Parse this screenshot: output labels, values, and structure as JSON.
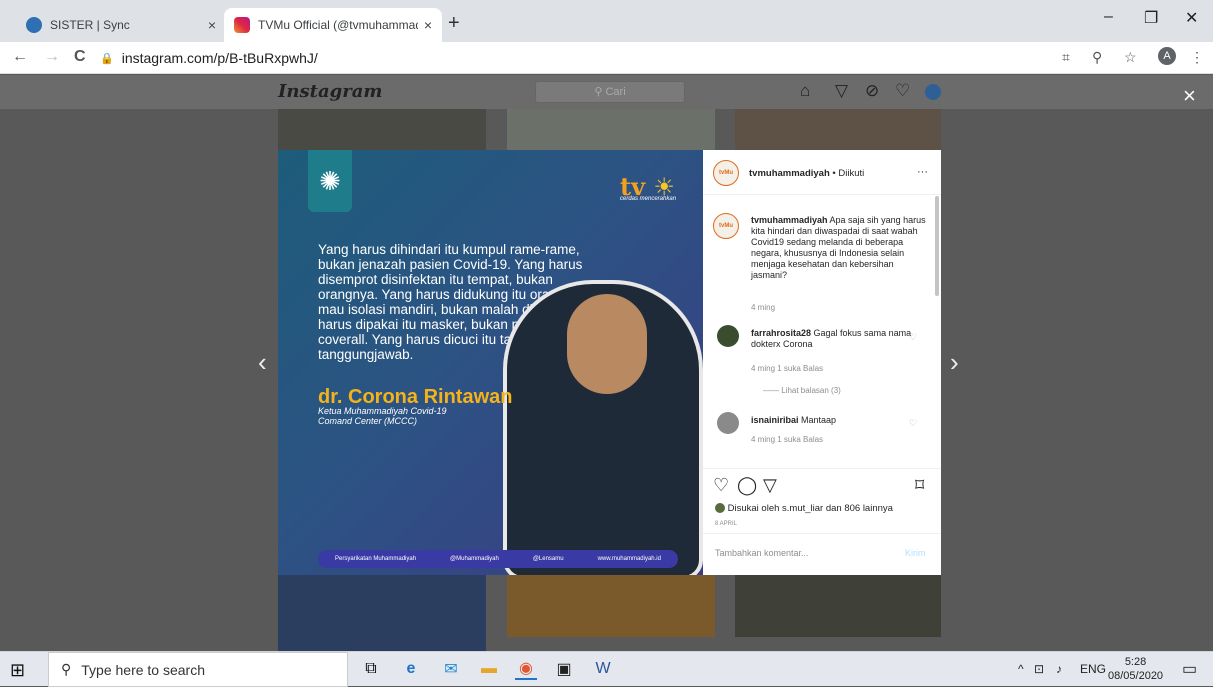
{
  "browser": {
    "tabs": [
      {
        "title": "SISTER | Sync",
        "close": "×"
      },
      {
        "title": "TVMu Official (@tvmuhammadiy",
        "close": "×"
      }
    ],
    "new_tab": "+",
    "url": "instagram.com/p/B-tBuRxpwhJ/",
    "profile_initial": "A",
    "window": {
      "minimize": "–",
      "maximize": "❐",
      "close": "✕"
    },
    "nav": {
      "back": "←",
      "forward": "→",
      "reload": "C"
    }
  },
  "instagram": {
    "logo": "Instagram",
    "search_placeholder": "Cari",
    "close": "×",
    "prev": "‹",
    "next": "›"
  },
  "post_image": {
    "quote": "Yang harus dihindari itu kumpul rame-rame, bukan jenazah pasien Covid-19. Yang harus disemprot disinfektan itu tempat, bukan orangnya. Yang harus didukung itu orang yang mau isolasi mandiri, bukan malah diusir. Yang harus dipakai itu masker, bukan pakaian coverall. Yang harus dicuci itu tangan, bukan tanggungjawab.",
    "name": "dr. Corona Rintawan",
    "role": "Ketua Muhammadiyah Covid-19 Comand Center (MCCC)",
    "tv_logo": "tv",
    "tv_tagline": "cerdas mencerahkan",
    "footer": [
      "Persyarikatan Muhammadiyah",
      "@Muhammadiyah",
      "@Lensamu",
      "www.muhammadiyah.id"
    ]
  },
  "panel": {
    "header_user": "tvmuhammadiyah",
    "header_follow": " • Diikuti",
    "more": "···",
    "caption_user": "tvmuhammadiyah",
    "caption_text": " Apa saja sih yang harus kita hindari dan diwaspadai di saat wabah Covid19 sedang melanda di beberapa negara, khususnya di Indonesia selain menjaga kesehatan dan kebersihan jasmani?",
    "caption_time": "4 ming",
    "comments": [
      {
        "user": "farrahrosita28",
        "text": " Gagal fokus sama nama dokterx Corona",
        "meta": "4 ming   1 suka   Balas"
      },
      {
        "user": "isnainiribai",
        "text": " Mantaap",
        "meta": "4 ming   1 suka   Balas"
      }
    ],
    "view_replies": "Lihat balasan (3)",
    "likes_text": "Disukai oleh s.mut_liar dan 806 lainnya",
    "date": "8 APRIL",
    "add_comment": "Tambahkan komentar...",
    "send": "Kirim"
  },
  "taskbar": {
    "search": "Type here to search",
    "lang": "ENG",
    "time": "5:28",
    "date": "08/05/2020"
  }
}
